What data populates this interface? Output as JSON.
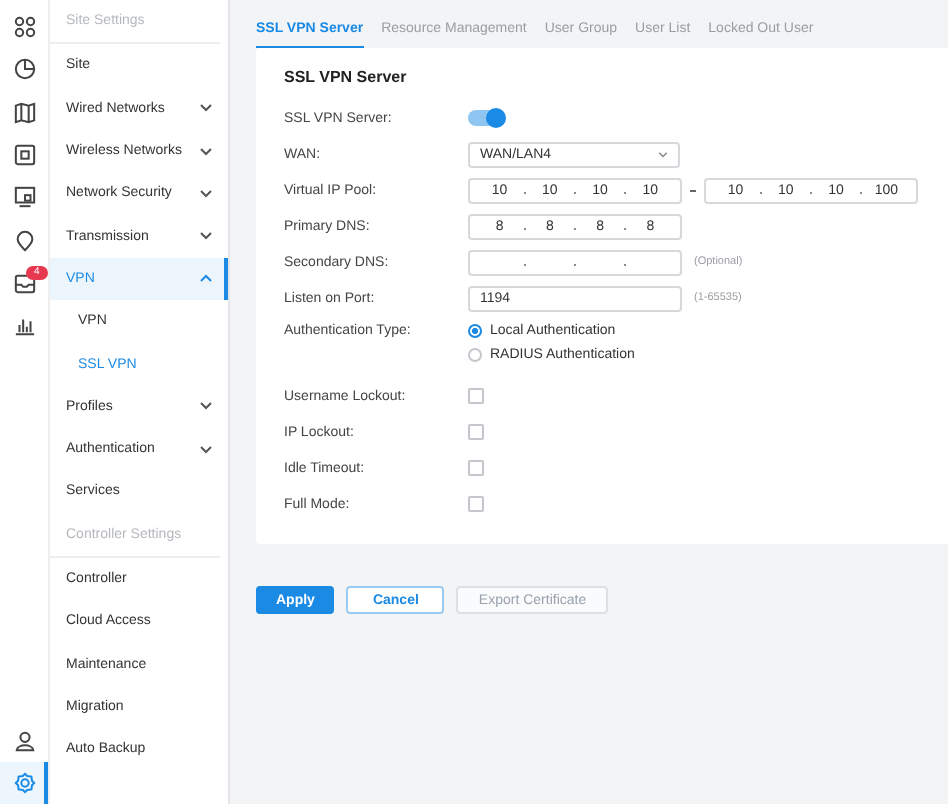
{
  "rail": {
    "top": [
      {
        "kind": "grid",
        "selected": false
      },
      {
        "kind": "pie",
        "selected": false
      },
      {
        "kind": "map",
        "selected": false
      },
      {
        "kind": "device",
        "selected": false
      },
      {
        "kind": "screen",
        "selected": false
      },
      {
        "kind": "pin",
        "selected": false
      },
      {
        "kind": "inbox",
        "selected": false,
        "badge": "4"
      },
      {
        "kind": "chart",
        "selected": false
      }
    ],
    "bottom": [
      {
        "kind": "user",
        "selected": false
      },
      {
        "kind": "gear",
        "selected": true
      }
    ]
  },
  "sidebar": [
    {
      "header": "Site Settings",
      "items": [
        {
          "label": "Site",
          "kind": "link",
          "selected": false
        },
        {
          "label": "Wired Networks",
          "kind": "group",
          "expanded": false,
          "selected": false
        },
        {
          "label": "Wireless Networks",
          "kind": "group",
          "expanded": false,
          "selected": false
        },
        {
          "label": "Network Security",
          "kind": "group",
          "expanded": false,
          "selected": false
        },
        {
          "label": "Transmission",
          "kind": "group",
          "expanded": false,
          "selected": false
        },
        {
          "label": "VPN",
          "kind": "group",
          "expanded": true,
          "selected": true,
          "children": [
            {
              "label": "VPN",
              "selected": false
            },
            {
              "label": "SSL VPN",
              "selected": true
            }
          ]
        },
        {
          "label": "Profiles",
          "kind": "group",
          "expanded": false,
          "selected": false
        },
        {
          "label": "Authentication",
          "kind": "group",
          "expanded": false,
          "selected": false
        },
        {
          "label": "Services",
          "kind": "link",
          "selected": false
        }
      ]
    },
    {
      "header": "Controller Settings",
      "items": [
        {
          "label": "Controller",
          "kind": "link",
          "selected": false
        },
        {
          "label": "Cloud Access",
          "kind": "link",
          "selected": false
        },
        {
          "label": "Maintenance",
          "kind": "link",
          "selected": false
        },
        {
          "label": "Migration",
          "kind": "link",
          "selected": false
        },
        {
          "label": "Auto Backup",
          "kind": "link",
          "selected": false
        }
      ]
    }
  ],
  "tabs": [
    {
      "label": "SSL VPN Server",
      "selected": true
    },
    {
      "label": "Resource Management",
      "selected": false
    },
    {
      "label": "User Group",
      "selected": false
    },
    {
      "label": "User List",
      "selected": false
    },
    {
      "label": "Locked Out User",
      "selected": false
    }
  ],
  "form": {
    "title": "SSL VPN Server",
    "fields": [
      {
        "kind": "toggle",
        "label": "SSL VPN Server:",
        "on": true
      },
      {
        "kind": "select",
        "label": "WAN:",
        "value": "WAN/LAN4"
      },
      {
        "kind": "ip_range",
        "label": "Virtual IP Pool:",
        "from": [
          "10",
          "10",
          "10",
          "10"
        ],
        "to": [
          "10",
          "10",
          "10",
          "100"
        ]
      },
      {
        "kind": "ip",
        "label": "Primary DNS:",
        "octets": [
          "8",
          "8",
          "8",
          "8"
        ]
      },
      {
        "kind": "ip",
        "label": "Secondary DNS:",
        "hint": "(Optional)"
      },
      {
        "kind": "text",
        "label": "Listen on Port:",
        "value": "1194",
        "hint": "(1-65535)"
      },
      {
        "kind": "radio",
        "label": "Authentication Type:",
        "options": [
          {
            "label": "Local Authentication",
            "selected": true
          },
          {
            "label": "RADIUS Authentication",
            "selected": false
          }
        ]
      },
      {
        "kind": "checkbox",
        "label": "Username Lockout:",
        "checked": false
      },
      {
        "kind": "checkbox",
        "label": "IP Lockout:",
        "checked": false
      },
      {
        "kind": "checkbox",
        "label": "Idle Timeout:",
        "checked": false
      },
      {
        "kind": "checkbox",
        "label": "Full Mode:",
        "checked": false
      }
    ]
  },
  "buttons": [
    {
      "label": "Apply",
      "kind": "primary",
      "disabled": false
    },
    {
      "label": "Cancel",
      "kind": "secondary",
      "disabled": false
    },
    {
      "label": "Export Certificate",
      "kind": "secondary",
      "disabled": true
    }
  ]
}
